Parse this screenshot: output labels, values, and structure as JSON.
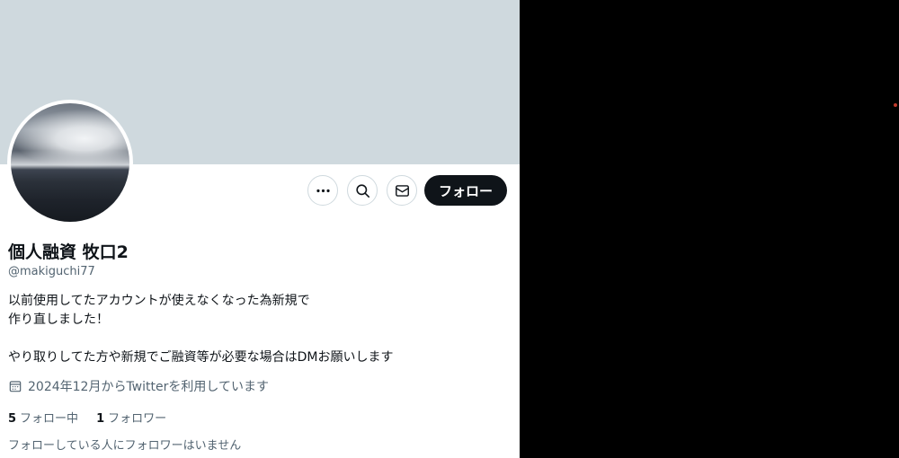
{
  "profile": {
    "display_name": "個人融資 牧口2",
    "handle": "@makiguchi77",
    "bio_lines": [
      "以前使用してたアカウントが使えなくなった為新規で",
      "作り直しました！",
      "やり取りしてた方や新規でご融資等が必要な場合はDMお願いします"
    ],
    "joined": "2024年12月からTwitterを利用しています",
    "following_count": "5",
    "following_label": "フォロー中",
    "followers_count": "1",
    "followers_label": "フォロワー",
    "no_known_followers": "フォローしている人にフォロワーはいません"
  },
  "actions": {
    "follow_label": "フォロー",
    "more_icon": "more-horizontal-icon",
    "search_icon": "search-icon",
    "message_icon": "envelope-icon"
  },
  "colors": {
    "banner": "#cfd9de",
    "text_primary": "#0f1419",
    "text_secondary": "#536471",
    "follow_button": "#0f1419",
    "outside": "#000000"
  }
}
